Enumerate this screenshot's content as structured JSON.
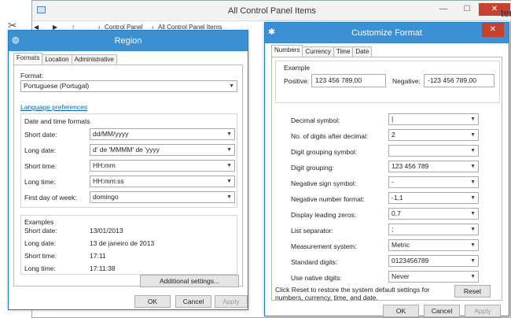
{
  "control_panel": {
    "title": "All Control Panel Items",
    "breadcrumb": [
      "Control Panel",
      "All Control Panel Items"
    ],
    "fragment": "ter"
  },
  "region": {
    "title": "Region",
    "tabs": [
      "Formats",
      "Location",
      "Administrative"
    ],
    "format_label": "Format:",
    "format_value": "Portuguese (Portugal)",
    "language_link": "Language preferences",
    "dt_group_label": "Date and time formats",
    "fields": [
      {
        "label": "Short date:",
        "value": "dd/MM/yyyy"
      },
      {
        "label": "Long date:",
        "value": "d' de 'MMMM' de 'yyyy"
      },
      {
        "label": "Short time:",
        "value": "HH:mm"
      },
      {
        "label": "Long time:",
        "value": "HH:mm:ss"
      },
      {
        "label": "First day of week:",
        "value": "domingo"
      }
    ],
    "examples_label": "Examples",
    "examples": [
      {
        "label": "Short date:",
        "value": "13/01/2013"
      },
      {
        "label": "Long date:",
        "value": "13 de janeiro de 2013"
      },
      {
        "label": "Short time:",
        "value": "17:11"
      },
      {
        "label": "Long time:",
        "value": "17:11:38"
      }
    ],
    "additional_btn": "Additional settings...",
    "ok": "OK",
    "cancel": "Cancel",
    "apply": "Apply"
  },
  "customize": {
    "title": "Customize Format",
    "tabs": [
      "Numbers",
      "Currency",
      "Time",
      "Date"
    ],
    "example_label": "Example",
    "positive_label": "Positive:",
    "positive_value": "123 456 789,00",
    "negative_label": "Negative:",
    "negative_value": "-123 456 789,00",
    "fields": [
      {
        "label": "Decimal symbol:",
        "value": "|"
      },
      {
        "label": "No. of digits after decimal:",
        "value": "2"
      },
      {
        "label": "Digit grouping symbol:",
        "value": ""
      },
      {
        "label": "Digit grouping:",
        "value": "123 456 789"
      },
      {
        "label": "Negative sign symbol:",
        "value": "-"
      },
      {
        "label": "Negative number format:",
        "value": "-1,1"
      },
      {
        "label": "Display leading zeros:",
        "value": "0,7"
      },
      {
        "label": "List separator:",
        "value": ";"
      },
      {
        "label": "Measurement system:",
        "value": "Metric"
      },
      {
        "label": "Standard digits:",
        "value": "0123456789"
      },
      {
        "label": "Use native digits:",
        "value": "Never"
      }
    ],
    "reset_text": "Click Reset to restore the system default settings for numbers, currency, time, and date.",
    "reset": "Reset",
    "ok": "OK",
    "cancel": "Cancel",
    "apply": "Apply"
  },
  "colors": {
    "accent": "#3c8fd3",
    "close": "#c7412e",
    "link": "#0a63b5"
  }
}
